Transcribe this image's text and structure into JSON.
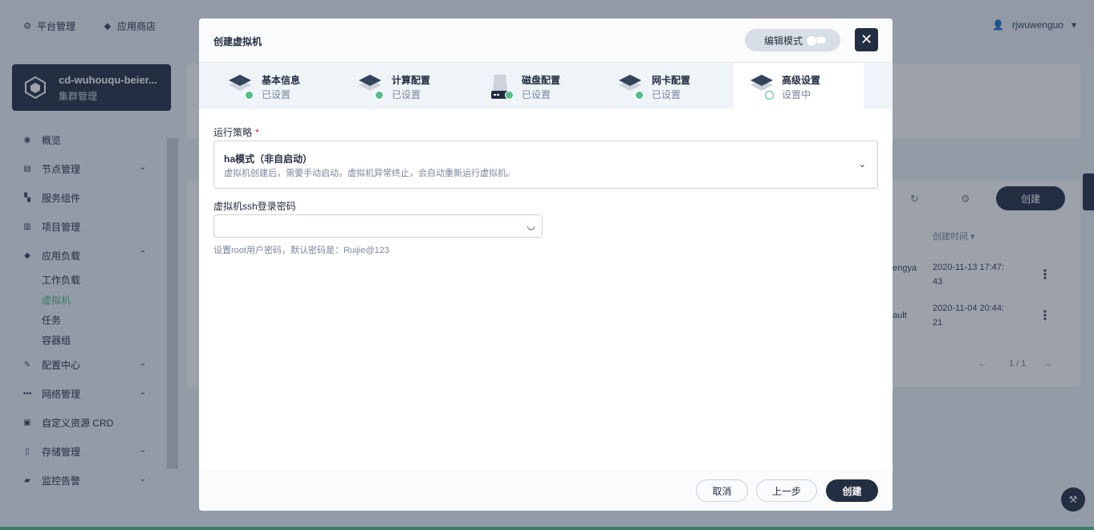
{
  "topnav": {
    "platform": "平台管理",
    "appstore": "应用商店",
    "user": "rjwuwenguo"
  },
  "sidebar": {
    "cluster_name": "cd-wuhouqu-beier...",
    "cluster_sub": "集群管理",
    "items": [
      {
        "label": "概览"
      },
      {
        "label": "节点管理"
      },
      {
        "label": "服务组件"
      },
      {
        "label": "项目管理"
      },
      {
        "label": "应用负载"
      },
      {
        "label": "配置中心"
      },
      {
        "label": "网络管理"
      },
      {
        "label": "自定义资源 CRD"
      },
      {
        "label": "存储管理"
      },
      {
        "label": "监控告警"
      }
    ],
    "workload_sub": [
      "工作负载",
      "虚拟机",
      "任务",
      "容器组"
    ]
  },
  "background": {
    "create_label": "创建",
    "col_created": "创建时间",
    "rows": [
      {
        "partial": "engya",
        "time1": "2020-11-13 17:47:",
        "time2": "43"
      },
      {
        "partial": "ault",
        "time1": "2020-11-04 20:44:",
        "time2": "21"
      }
    ],
    "pager": "1 / 1"
  },
  "modal": {
    "title": "创建虚拟机",
    "edit_mode": "编辑模式",
    "steps": [
      {
        "title": "基本信息",
        "status": "已设置"
      },
      {
        "title": "计算配置",
        "status": "已设置"
      },
      {
        "title": "磁盘配置",
        "status": "已设置"
      },
      {
        "title": "网卡配置",
        "status": "已设置"
      },
      {
        "title": "高级设置",
        "status": "设置中"
      }
    ],
    "run_policy_label": "运行策略",
    "run_policy_value": "ha模式（非自启动）",
    "run_policy_desc": "虚拟机创建后，需要手动启动。虚拟机异常终止，会自动重新运行虚拟机。",
    "ssh_label": "虚拟机ssh登录密码",
    "ssh_value": "",
    "ssh_hint": "设置root用户密码，默认密码是：Ruijie@123",
    "cancel": "取消",
    "prev": "上一步",
    "create": "创建"
  },
  "colors": {
    "dark": "#242e42",
    "green": "#55bc8a",
    "muted": "#79879c"
  }
}
